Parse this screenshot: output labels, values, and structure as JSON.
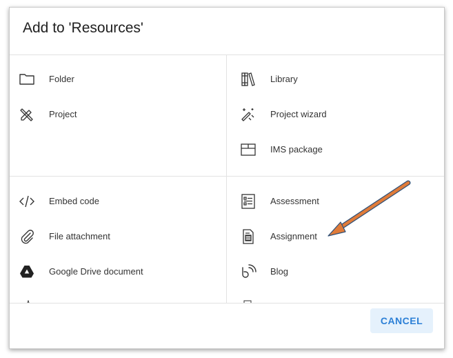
{
  "dialog": {
    "title": "Add to 'Resources'",
    "sections": [
      {
        "left": [
          {
            "label": "Folder",
            "icon": "folder-icon"
          },
          {
            "label": "Project",
            "icon": "project-pencil-icon"
          }
        ],
        "right": [
          {
            "label": "Library",
            "icon": "library-icon"
          },
          {
            "label": "Project wizard",
            "icon": "magic-wand-icon"
          },
          {
            "label": "IMS package",
            "icon": "package-box-icon"
          }
        ]
      },
      {
        "left": [
          {
            "label": "Embed code",
            "icon": "code-icon"
          },
          {
            "label": "File attachment",
            "icon": "paperclip-icon"
          },
          {
            "label": "Google Drive document",
            "icon": "google-drive-icon"
          }
        ],
        "right": [
          {
            "label": "Assessment",
            "icon": "checklist-icon"
          },
          {
            "label": "Assignment",
            "icon": "assignment-icon"
          },
          {
            "label": "Blog",
            "icon": "blog-icon"
          }
        ]
      }
    ],
    "cancel_label": "CANCEL"
  },
  "colors": {
    "accent": "#2b7fd6",
    "annotation_arrow": "#e07b39"
  }
}
